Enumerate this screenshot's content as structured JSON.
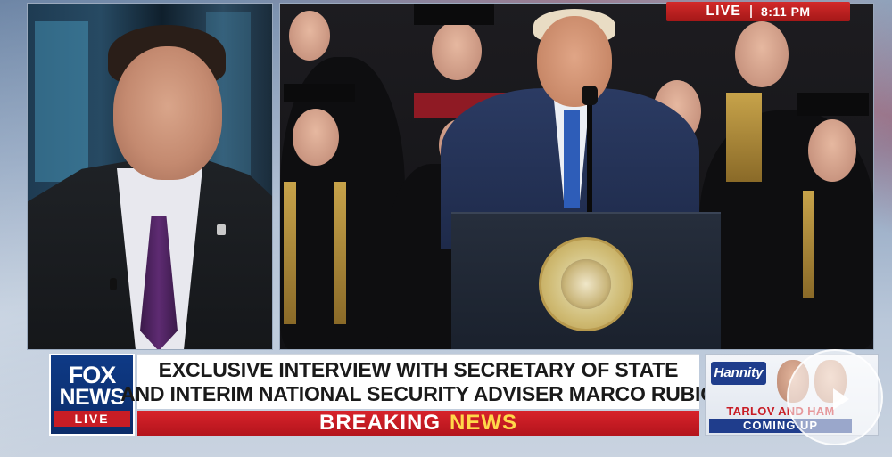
{
  "live_badge": {
    "label": "LIVE",
    "time": "8:11 PM"
  },
  "network_logo": {
    "line1": "FOX",
    "line2": "NEWS",
    "live": "LIVE"
  },
  "headline": {
    "line1": "EXCLUSIVE INTERVIEW WITH SECRETARY OF STATE",
    "line2": "AND INTERIM NATIONAL SECURITY ADVISER MARCO RUBIO"
  },
  "banner": {
    "word1": "BREAKING",
    "word2": "NEWS"
  },
  "promo": {
    "show": "Hannity",
    "names": "TARLOV AND HAM",
    "coming": "COMING UP"
  },
  "colors": {
    "brand_red": "#c81d25",
    "brand_blue": "#0e3a86",
    "accent_yellow": "#ffd84a"
  }
}
